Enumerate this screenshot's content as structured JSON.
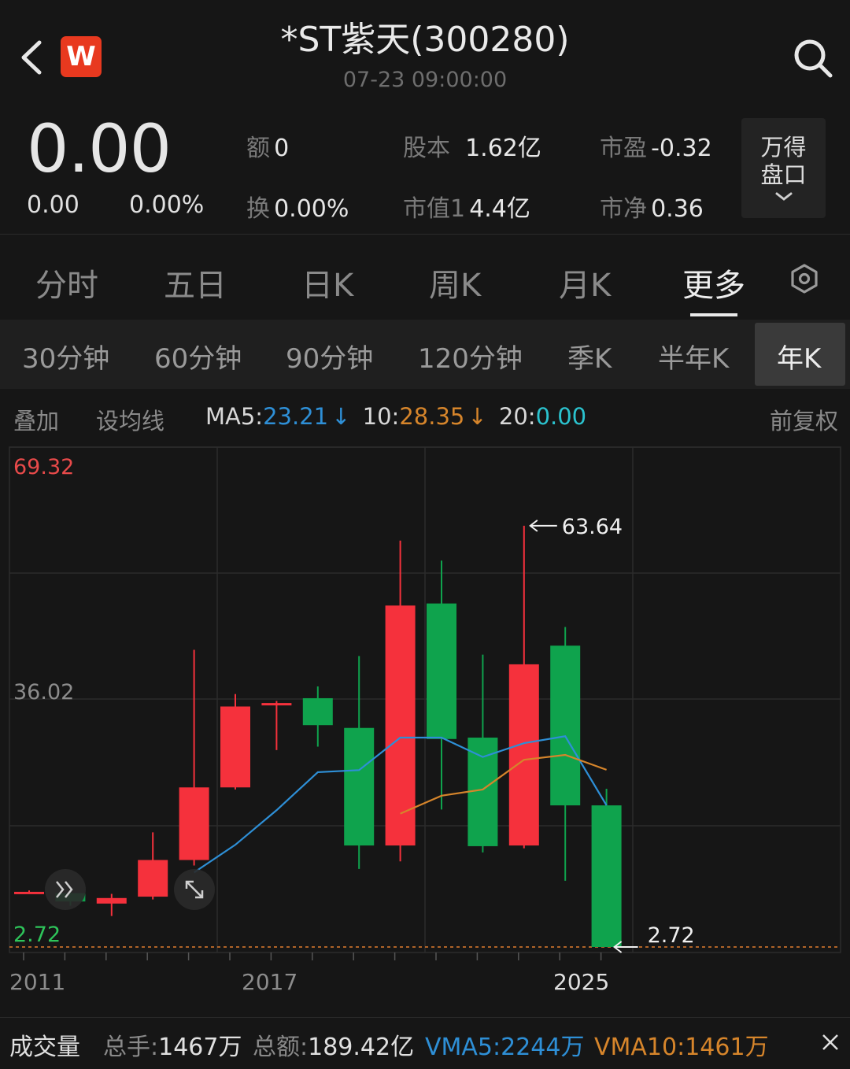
{
  "header": {
    "title": "*ST紫天(300280)",
    "subtitle": "07-23 09:00:00",
    "logo_letter": "W"
  },
  "quote": {
    "price": "0.00",
    "change": "0.00",
    "change_pct": "0.00%",
    "fields": [
      {
        "label": "额",
        "value": "0"
      },
      {
        "label": "股本",
        "value": "1.62亿"
      },
      {
        "label": "市盈",
        "value": "-0.32"
      },
      {
        "label": "换",
        "value": "0.00%"
      },
      {
        "label": "市值1",
        "value": "4.4亿"
      },
      {
        "label": "市净",
        "value": "0.36"
      }
    ],
    "panel_button": {
      "line1": "万得",
      "line2": "盘口"
    }
  },
  "period_tabs": [
    "分时",
    "五日",
    "日K",
    "周K",
    "月K",
    "更多"
  ],
  "period_active": "更多",
  "sub_tabs": [
    "30分钟",
    "60分钟",
    "90分钟",
    "120分钟",
    "季K",
    "半年K",
    "年K"
  ],
  "sub_active": "年K",
  "indicators": {
    "overlay": "叠加",
    "set_ma": "设均线",
    "ma5_label": "MA5:",
    "ma5_value": "23.21",
    "ma10_label": "10:",
    "ma10_value": "28.35",
    "ma20_label": "20:",
    "ma20_value": "0.00",
    "down_arrow": "↓",
    "adjust": "前复权"
  },
  "colors": {
    "up": "#f5313c",
    "down": "#0fa34d",
    "ma5": "#2e8fd6",
    "ma10": "#d6852b",
    "ma20": "#2bc3cf",
    "axis_max": "#e84a4a",
    "axis_min": "#2ec45a"
  },
  "chart_data": {
    "type": "candlestick",
    "y_labels": {
      "max": "69.32",
      "mid": "36.02",
      "min": "2.72"
    },
    "ylim": [
      2.72,
      69.32
    ],
    "x_labels": [
      "2011",
      "2017",
      "2025"
    ],
    "annotations": {
      "high": "63.64",
      "low": "2.72"
    },
    "candles": [
      {
        "year": 2011,
        "open": 10.7,
        "close": 10.7,
        "high": 10.9,
        "low": 10.5
      },
      {
        "year": 2012,
        "open": 10.5,
        "close": 9.3,
        "high": 10.9,
        "low": 8.7
      },
      {
        "year": 2013,
        "open": 9.0,
        "close": 9.8,
        "high": 10.4,
        "low": 7.2
      },
      {
        "year": 2014,
        "open": 10.0,
        "close": 15.3,
        "high": 19.3,
        "low": 9.6
      },
      {
        "year": 2015,
        "open": 15.3,
        "close": 25.8,
        "high": 45.7,
        "low": 14.5
      },
      {
        "year": 2016,
        "open": 25.8,
        "close": 37.5,
        "high": 39.3,
        "low": 25.5
      },
      {
        "year": 2017,
        "open": 38.0,
        "close": 38.0,
        "high": 38.3,
        "low": 31.2
      },
      {
        "year": 2018,
        "open": 38.7,
        "close": 34.8,
        "high": 40.4,
        "low": 31.7
      },
      {
        "year": 2019,
        "open": 34.4,
        "close": 17.4,
        "high": 44.8,
        "low": 14.0
      },
      {
        "year": 2020,
        "open": 17.4,
        "close": 52.1,
        "high": 61.5,
        "low": 15.1
      },
      {
        "year": 2021,
        "open": 52.4,
        "close": 32.8,
        "high": 58.6,
        "low": 22.6
      },
      {
        "year": 2022,
        "open": 33.0,
        "close": 17.3,
        "high": 45.0,
        "low": 16.4
      },
      {
        "year": 2023,
        "open": 17.4,
        "close": 43.6,
        "high": 63.64,
        "low": 17.0
      },
      {
        "year": 2024,
        "open": 46.3,
        "close": 23.2,
        "high": 49.0,
        "low": 12.3
      },
      {
        "year": 2025,
        "open": 23.2,
        "close": 2.72,
        "high": 25.6,
        "low": 2.72
      }
    ],
    "ma5": [
      {
        "year": 2015,
        "value": 13.5
      },
      {
        "year": 2016,
        "value": 17.5
      },
      {
        "year": 2017,
        "value": 22.5
      },
      {
        "year": 2018,
        "value": 28.0
      },
      {
        "year": 2019,
        "value": 28.3
      },
      {
        "year": 2020,
        "value": 33.0
      },
      {
        "year": 2021,
        "value": 33.0
      },
      {
        "year": 2022,
        "value": 30.2
      },
      {
        "year": 2023,
        "value": 32.2
      },
      {
        "year": 2024,
        "value": 33.2
      },
      {
        "year": 2025,
        "value": 23.21
      }
    ],
    "ma10": [
      {
        "year": 2020,
        "value": 22.0
      },
      {
        "year": 2021,
        "value": 24.6
      },
      {
        "year": 2022,
        "value": 25.5
      },
      {
        "year": 2023,
        "value": 29.8
      },
      {
        "year": 2024,
        "value": 30.5
      },
      {
        "year": 2025,
        "value": 28.35
      }
    ]
  },
  "volume": {
    "label": "成交量",
    "total_hands_label": "总手:",
    "total_hands": "1467万",
    "total_amount_label": "总额:",
    "total_amount": "189.42亿",
    "vma5_label": "VMA5:",
    "vma5": "2244万",
    "vma10_label": "VMA10:",
    "vma10": "1461万"
  }
}
